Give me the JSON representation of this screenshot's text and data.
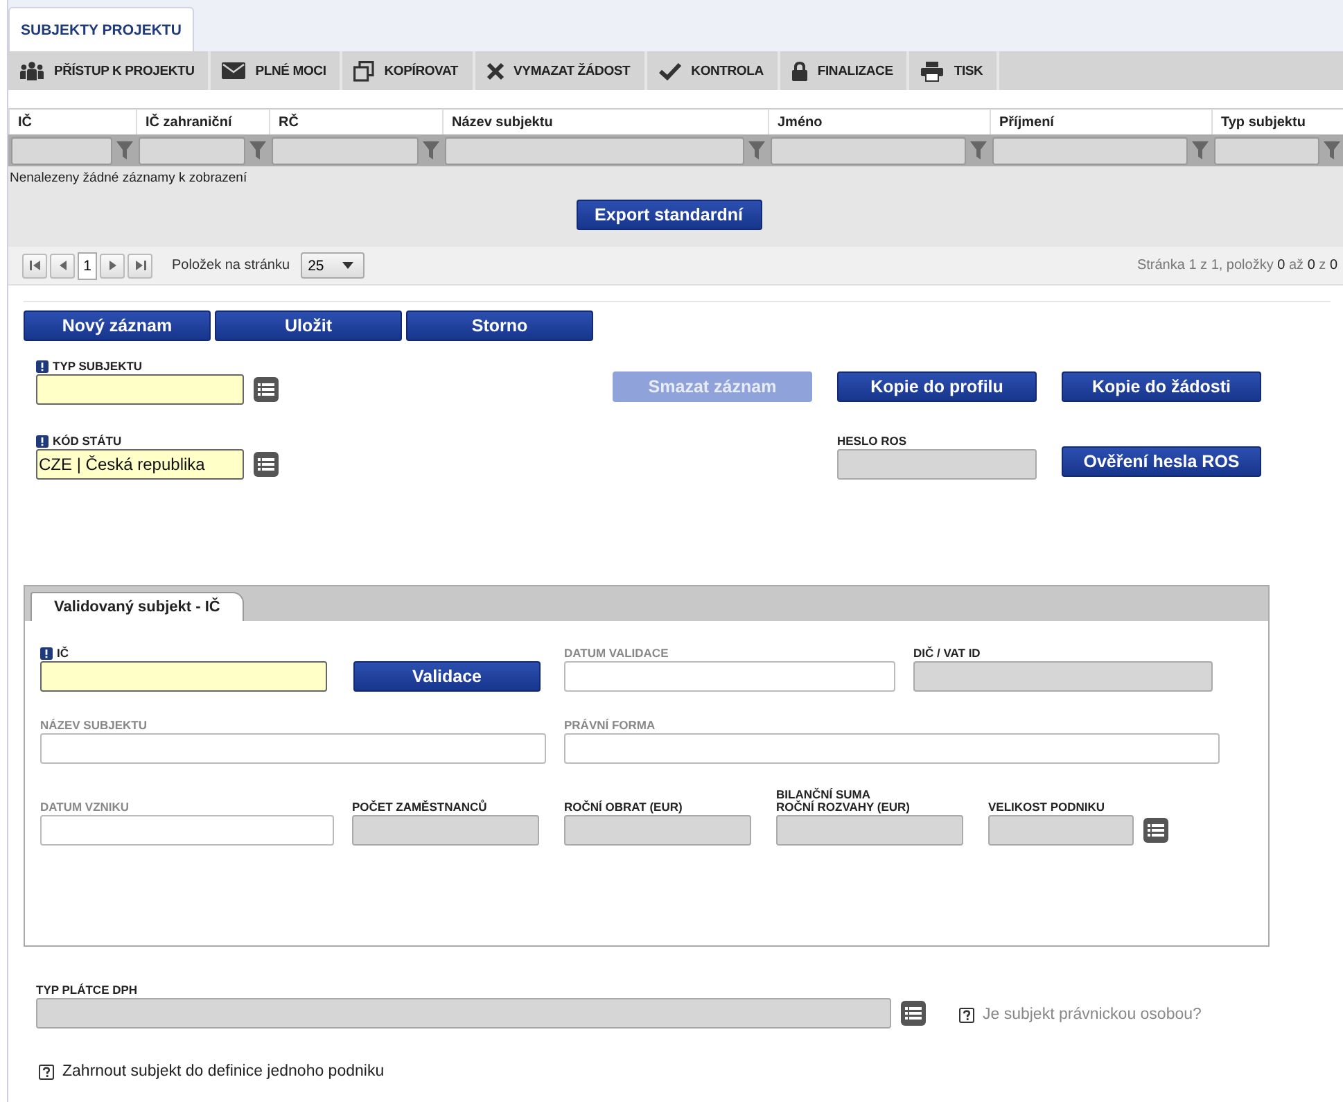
{
  "tabs": [
    {
      "label": "SUBJEKTY PROJEKTU",
      "selected": true
    }
  ],
  "toolbar": [
    "PŘÍSTUP K PROJEKTU",
    "PLNÉ MOCI",
    "KOPÍROVAT",
    "VYMAZAT ŽÁDOST",
    "KONTROLA",
    "FINALIZACE",
    "TISK"
  ],
  "table": {
    "columns": [
      "IČ",
      "IČ zahraniční",
      "RČ",
      "Název subjektu",
      "Jméno",
      "Příjmení",
      "Typ subjektu"
    ],
    "empty_message": "Nenalezeny žádné záznamy k zobrazení"
  },
  "export_button": "Export standardní",
  "pager": {
    "page": "1",
    "per_page_label": "Položek na stránku",
    "per_page": "25",
    "summary": "Stránka 1 z 1, položky **0** až **0** z **0**"
  },
  "actions": [
    "Nový záznam",
    "Uložit",
    "Storno"
  ],
  "subject_type": {
    "label": "TYP SUBJEKTU",
    "kind": "required",
    "picker": true
  },
  "record_buttons": [
    {
      "label": "Smazat záznam",
      "disabled": true
    },
    {
      "label": "Kopie do profilu",
      "disabled": false
    },
    {
      "label": "Kopie do žádosti",
      "disabled": false
    }
  ],
  "country": {
    "label": "KÓD STÁTU",
    "kind": "required",
    "picker": true,
    "value": "CZE | Česká republika"
  },
  "ros_password": {
    "label": "HESLO ROS",
    "kind": "readonly"
  },
  "verify_button": "Ověření hesla ROS",
  "subtabs": [
    {
      "label": "Validovaný subjekt - IČ",
      "selected": true
    }
  ],
  "validation_rows": [
    [
      {
        "label": "IČ",
        "kind": "required"
      },
      {
        "label": "Validace",
        "kind": "button"
      },
      {
        "label": "DATUM VALIDACE",
        "kind": "optional"
      },
      {
        "label": "DIČ / VAT ID",
        "kind": "readonly"
      }
    ],
    [
      {
        "label": "NÁZEV SUBJEKTU",
        "kind": "optional"
      },
      {
        "label": "PRÁVNÍ FORMA",
        "kind": "optional"
      }
    ],
    [
      {
        "label": "DATUM VZNIKU",
        "kind": "optional"
      },
      {
        "label": "POČET ZAMĚSTNANCŮ",
        "kind": "readonly"
      },
      {
        "label": "ROČNÍ OBRAT (EUR)",
        "kind": "readonly"
      },
      {
        "label": "BILANČNÍ SUMA\nROČNÍ ROZVAHY (EUR)",
        "kind": "readonly"
      },
      {
        "label": "VELIKOST PODNIKU",
        "kind": "readonly",
        "picker": true
      }
    ]
  ],
  "vat_payer": {
    "label": "TYP PLÁTCE DPH",
    "kind": "readonly",
    "picker": true
  },
  "options": [
    {
      "label": "Je subjekt právnickou osobou?",
      "disabled": true
    },
    {
      "label": "Zahrnout subjekt do definice jednoho podniku",
      "disabled": false
    }
  ]
}
